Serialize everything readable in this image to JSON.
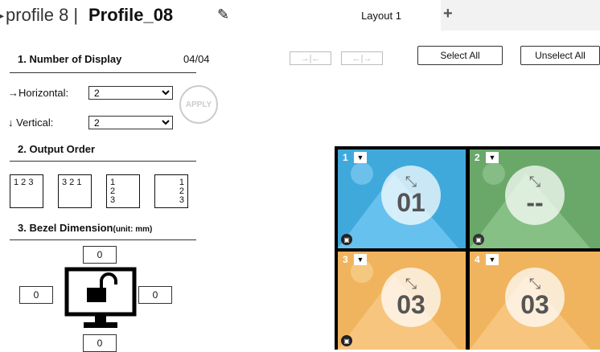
{
  "header": {
    "profile_prefix": "profile 8 |",
    "profile_name": "Profile_08",
    "edit_icon": "pencil-icon"
  },
  "tabs": [
    {
      "label": "Layout 1",
      "active": true
    },
    {
      "label": "+",
      "active": false
    }
  ],
  "section1": {
    "title": "1.  Number of Display",
    "count": "04/04",
    "horizontal_label": "Horizontal:",
    "horizontal_value": "2",
    "vertical_label": "Vertical:",
    "vertical_value": "2",
    "apply_label": "APPLY"
  },
  "section2": {
    "title": "2.  Output Order",
    "options": [
      {
        "rows": [
          "1 2 3"
        ]
      },
      {
        "rows": [
          "3 2 1"
        ]
      },
      {
        "rows": [
          "1",
          "2",
          "3"
        ]
      },
      {
        "rows": [
          "1",
          "2",
          "3"
        ]
      }
    ]
  },
  "section3": {
    "title": "3.  Bezel Dimension",
    "unit": "(unit: mm)",
    "top": "0",
    "left": "0",
    "right": "0",
    "bottom": "0"
  },
  "toolbar": {
    "select_all": "Select All",
    "unselect_all": "Unselect All"
  },
  "displays": [
    {
      "index": "1",
      "source": "01",
      "color": "#3fa9dc"
    },
    {
      "index": "2",
      "source": "--",
      "color": "#6aa869"
    },
    {
      "index": "3",
      "source": "03",
      "color": "#f0b45e"
    },
    {
      "index": "4",
      "source": "03",
      "color": "#f0b45e"
    }
  ]
}
